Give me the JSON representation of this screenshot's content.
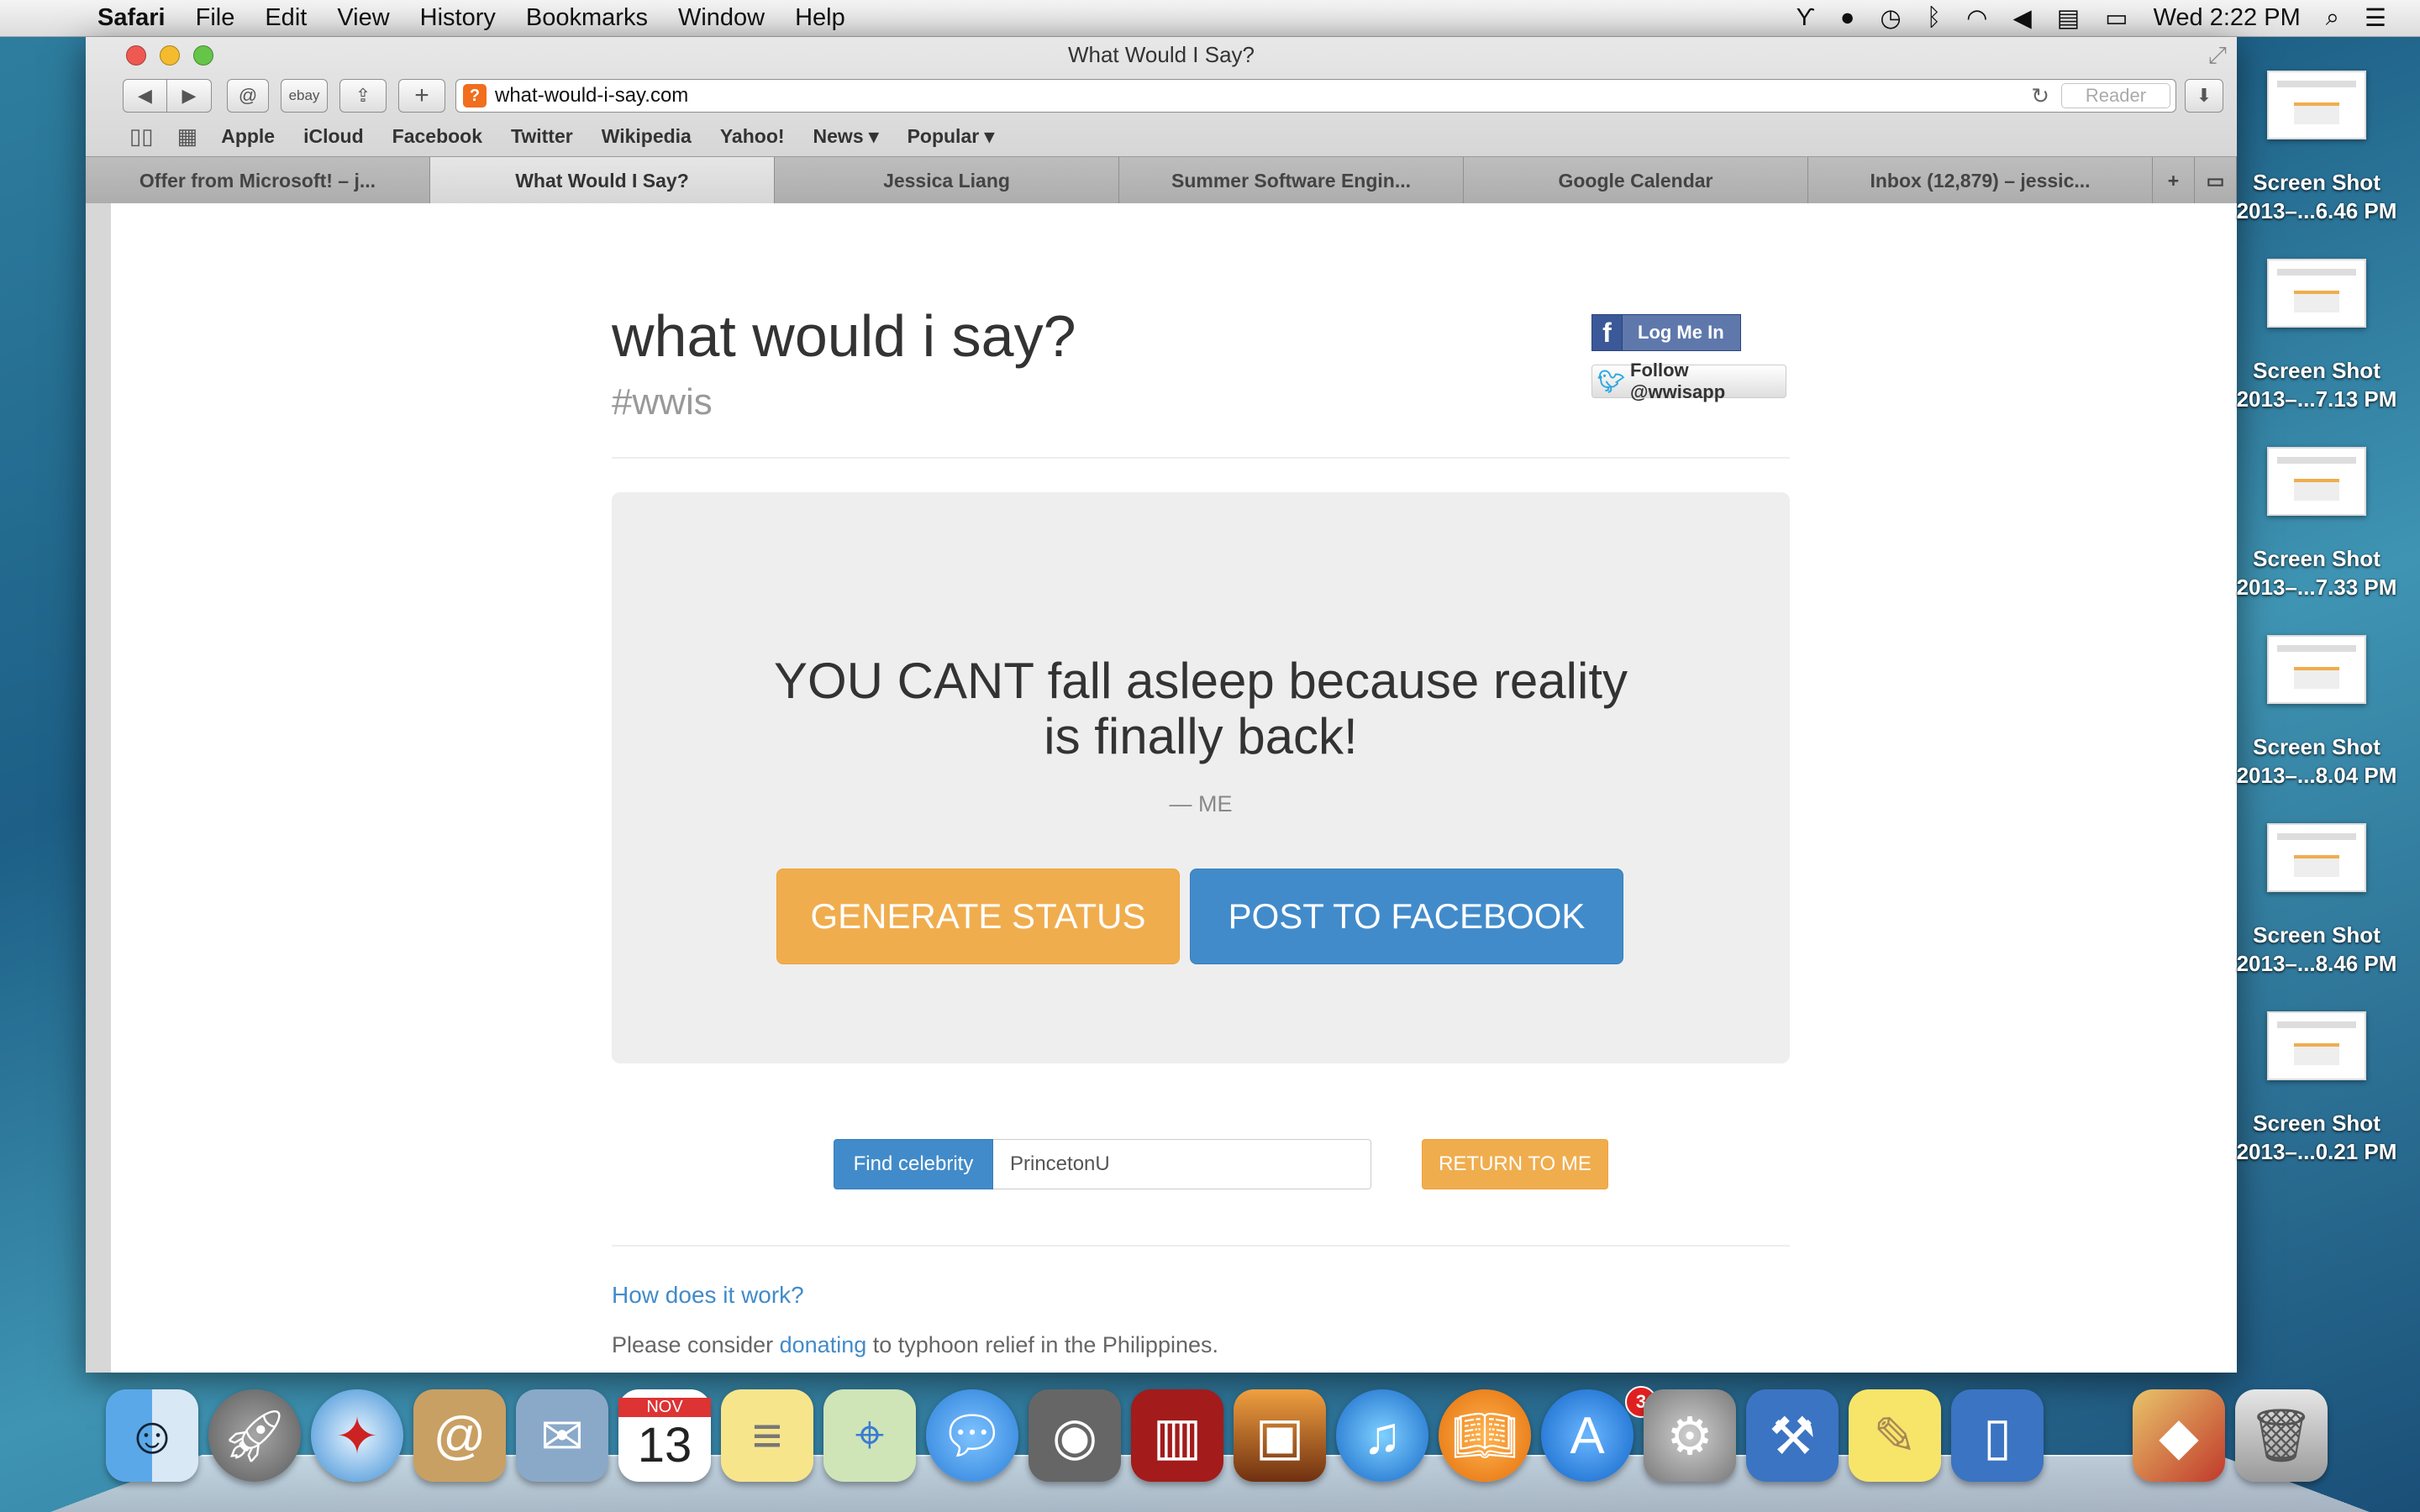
{
  "menubar": {
    "app_name": "Safari",
    "menus": [
      "File",
      "Edit",
      "View",
      "History",
      "Bookmarks",
      "Window",
      "Help"
    ],
    "clock": "Wed 2:22 PM"
  },
  "window": {
    "title": "What Would I Say?",
    "url": "what-would-i-say.com",
    "reader_label": "Reader",
    "toolbar_buttons": {
      "ebay": "ebay"
    }
  },
  "bookmarks": [
    "Apple",
    "iCloud",
    "Facebook",
    "Twitter",
    "Wikipedia",
    "Yahoo!",
    "News ▾",
    "Popular ▾"
  ],
  "tabs": [
    "Offer from Microsoft! – j...",
    "What Would I Say?",
    "Jessica Liang",
    "Summer Software Engin...",
    "Google Calendar",
    "Inbox (12,879) – jessic..."
  ],
  "site": {
    "title": "what would i say?",
    "hashtag": "#wwis",
    "fb_login_label": "Log Me In",
    "twitter_follow_label": "Follow @wwisapp",
    "quote_line1": "YOU CANT fall asleep because reality",
    "quote_line2": "is finally back!",
    "quote_author": "— ME",
    "generate_label": "GENERATE STATUS",
    "post_label": "POST TO FACEBOOK",
    "find_label": "Find celebrity",
    "celebrity_value": "PrincetonU",
    "return_label": "RETURN TO ME",
    "how_link": "How does it work?",
    "donate_prefix": "Please consider ",
    "donate_link": "donating",
    "donate_suffix": " to typhoon relief in the Philippines."
  },
  "desktop": [
    {
      "name": "Screen Shot",
      "date": "2013–...6.46 PM"
    },
    {
      "name": "Screen Shot",
      "date": "2013–...7.13 PM"
    },
    {
      "name": "Screen Shot",
      "date": "2013–...7.33 PM"
    },
    {
      "name": "Screen Shot",
      "date": "2013–...8.04 PM"
    },
    {
      "name": "Screen Shot",
      "date": "2013–...8.46 PM"
    },
    {
      "name": "Screen Shot",
      "date": "2013–...0.21 PM"
    }
  ],
  "dock": {
    "calendar_month": "NOV",
    "calendar_day": "13",
    "appstore_badge": "3",
    "apps": [
      "finder-icon",
      "launchpad-icon",
      "safari-icon",
      "contacts-icon",
      "mail-icon",
      "calendar-icon",
      "notes-icon",
      "maps-icon",
      "messages-icon",
      "facetime-icon",
      "photobooth-icon",
      "iphoto-icon",
      "itunes-icon",
      "ibooks-icon",
      "appstore-icon",
      "system-preferences-icon",
      "xcode-icon",
      "stickies-icon",
      "simulator-icon",
      "papers-icon",
      "trash-icon"
    ]
  },
  "colors": {
    "primary_blue": "#428bca",
    "warning_orange": "#f0ad4e",
    "facebook_blue": "#3b5998",
    "twitter_blue": "#2ea9e0"
  }
}
